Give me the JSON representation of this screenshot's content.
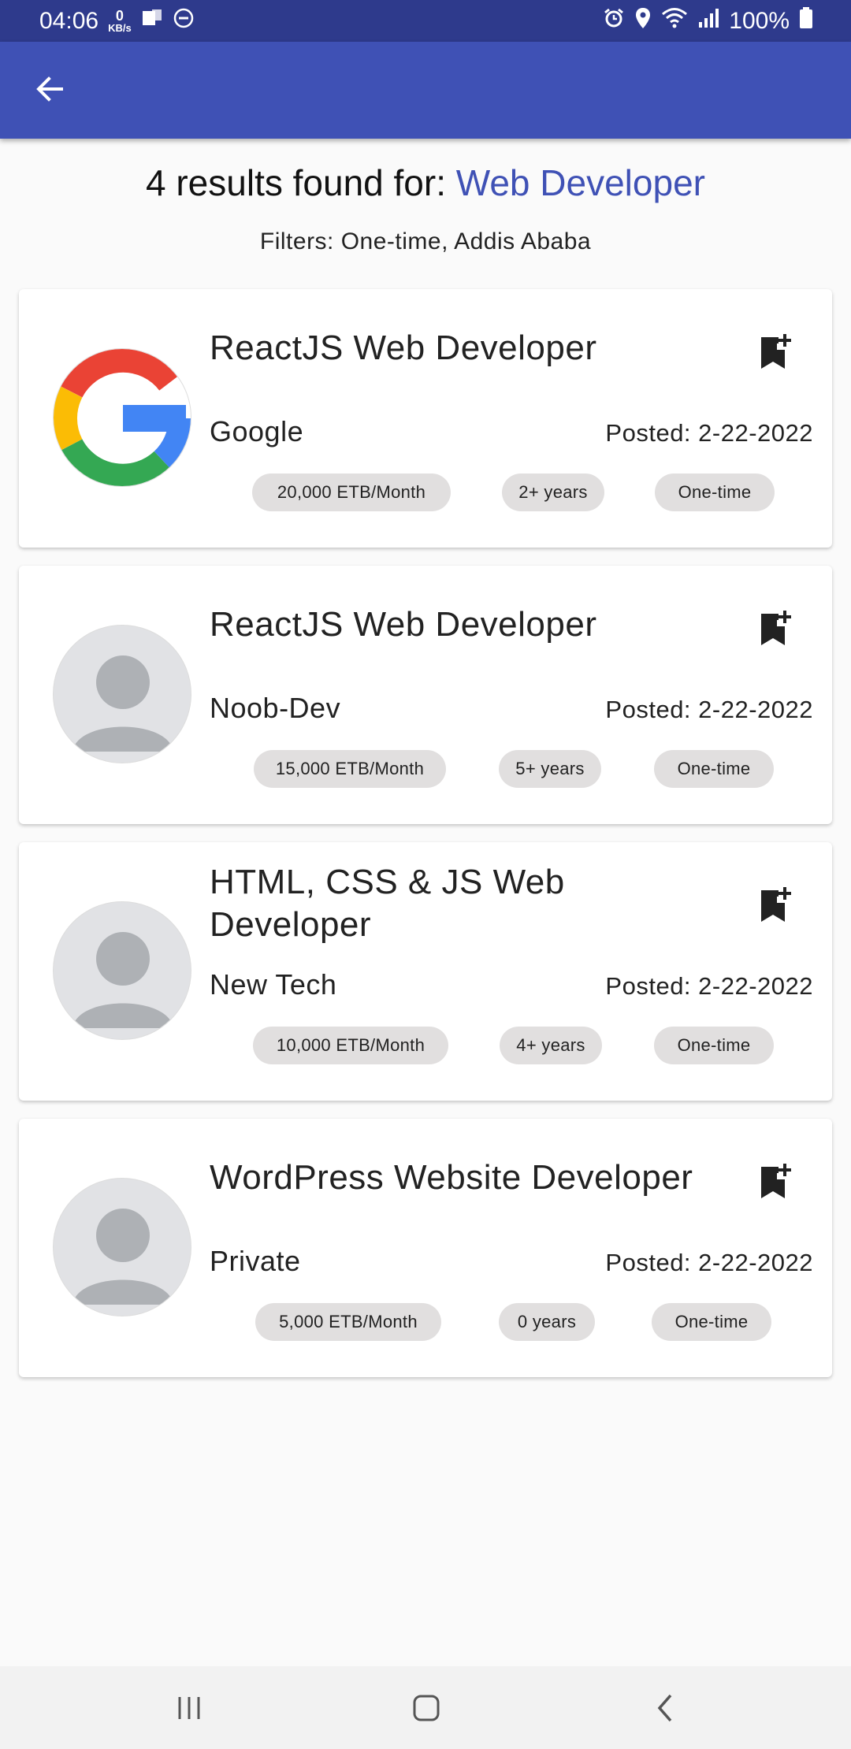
{
  "status_bar": {
    "time": "04:06",
    "net_speed_value": "0",
    "net_speed_unit": "KB/s",
    "battery": "100%"
  },
  "search": {
    "results_prefix": "4 results found for: ",
    "query": "Web Developer",
    "filters": "Filters: One-time, Addis Ababa"
  },
  "jobs": [
    {
      "title": "ReactJS Web Developer",
      "company": "Google",
      "posted": "Posted: 2-22-2022",
      "salary": "20,000 ETB/Month",
      "experience": "2+ years",
      "type": "One-time",
      "logo": "google-logo"
    },
    {
      "title": "ReactJS Web Developer",
      "company": "Noob-Dev",
      "posted": "Posted: 2-22-2022",
      "salary": "15,000 ETB/Month",
      "experience": "5+ years",
      "type": "One-time",
      "logo": "default-avatar"
    },
    {
      "title": "HTML, CSS & JS Web Developer",
      "company": "New Tech",
      "posted": "Posted: 2-22-2022",
      "salary": "10,000 ETB/Month",
      "experience": "4+ years",
      "type": "One-time",
      "logo": "default-avatar"
    },
    {
      "title": "WordPress Website Developer",
      "company": "Private",
      "posted": "Posted: 2-22-2022",
      "salary": "5,000 ETB/Month",
      "experience": "0 years",
      "type": "One-time",
      "logo": "default-avatar"
    }
  ],
  "colors": {
    "status_bar": "#2e3a8c",
    "app_bar": "#3f51b5",
    "accent": "#3f51b5",
    "chip": "#e1dfdf",
    "background": "#fafafa"
  }
}
